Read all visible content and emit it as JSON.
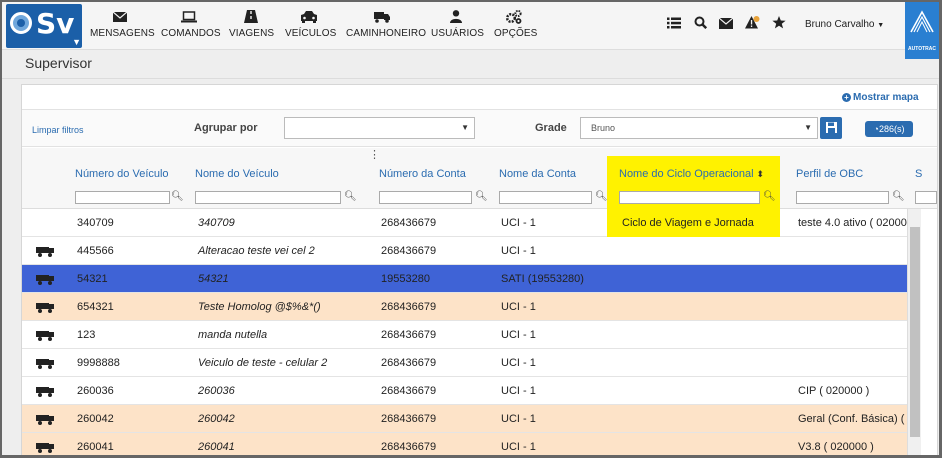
{
  "nav": {
    "logo_text": "Sv",
    "items": [
      {
        "label": "MENSAGENS",
        "icon": "envelope-icon"
      },
      {
        "label": "COMANDOS",
        "icon": "laptop-icon"
      },
      {
        "label": "VIAGENS",
        "icon": "road-icon"
      },
      {
        "label": "VEÍCULOS",
        "icon": "car-icon"
      },
      {
        "label": "CAMINHONEIRO",
        "icon": "truck-icon"
      },
      {
        "label": "USUÁRIOS",
        "icon": "user-icon"
      },
      {
        "label": "OPÇÕES",
        "icon": "cogs-icon"
      }
    ],
    "user_name": "Bruno Carvalho",
    "brand": "AUTOTRAC"
  },
  "page": {
    "title": "Supervisor",
    "show_map": "Mostrar mapa"
  },
  "filters": {
    "clear_label": "Limpar filtros",
    "group_by_label": "Agrupar por",
    "group_by_value": "",
    "grid_label": "Grade",
    "grid_value": "Bruno",
    "count": "286(s)"
  },
  "columns": [
    {
      "label": "Número do Veículo"
    },
    {
      "label": "Nome do Veículo"
    },
    {
      "label": "Número da Conta"
    },
    {
      "label": "Nome da Conta"
    },
    {
      "label": "Nome do Ciclo Operacional"
    },
    {
      "label": "Perfil de OBC"
    },
    {
      "label": "S"
    }
  ],
  "rows": [
    {
      "numero": "340709",
      "nome": "340709",
      "conta": "268436679",
      "nome_conta": "UCI - 1",
      "ciclo": "Ciclo de Viagem e Jornada",
      "perfil": "teste 4.0 ativo ( 02000",
      "icon": "",
      "style": "white"
    },
    {
      "numero": "445566",
      "nome": "Alteracao teste vei cel 2",
      "conta": "268436679",
      "nome_conta": "UCI - 1",
      "ciclo": "",
      "perfil": "",
      "icon": "truck-icon",
      "style": "white"
    },
    {
      "numero": "54321",
      "nome": "54321",
      "conta": "19553280",
      "nome_conta": "SATI (19553280)",
      "ciclo": "",
      "perfil": "",
      "icon": "truck-icon",
      "style": "selected"
    },
    {
      "numero": "654321",
      "nome": "Teste Homolog @$%&*()",
      "conta": "268436679",
      "nome_conta": "UCI - 1",
      "ciclo": "",
      "perfil": "",
      "icon": "truck-icon",
      "style": "peach"
    },
    {
      "numero": "123",
      "nome": "manda nutella",
      "conta": "268436679",
      "nome_conta": "UCI - 1",
      "ciclo": "",
      "perfil": "",
      "icon": "truck-icon",
      "style": "white"
    },
    {
      "numero": "9998888",
      "nome": "Veiculo de teste - celular 2",
      "conta": "268436679",
      "nome_conta": "UCI - 1",
      "ciclo": "",
      "perfil": "",
      "icon": "truck-icon",
      "style": "white"
    },
    {
      "numero": "260036",
      "nome": "260036",
      "conta": "268436679",
      "nome_conta": "UCI - 1",
      "ciclo": "",
      "perfil": "CIP ( 020000 )",
      "icon": "truck-icon",
      "style": "white"
    },
    {
      "numero": "260042",
      "nome": "260042",
      "conta": "268436679",
      "nome_conta": "UCI - 1",
      "ciclo": "",
      "perfil": "Geral (Conf. Básica) (",
      "icon": "truck-icon",
      "style": "peach"
    },
    {
      "numero": "260041",
      "nome": "260041",
      "conta": "268436679",
      "nome_conta": "UCI - 1",
      "ciclo": "",
      "perfil": "V3.8 ( 020000 )",
      "icon": "truck-icon",
      "style": "peach"
    }
  ],
  "colors": {
    "accent": "#2b6cb0",
    "selected_row": "#3f63d6",
    "peach_row": "#fde3c8",
    "highlight": "#fff200"
  }
}
